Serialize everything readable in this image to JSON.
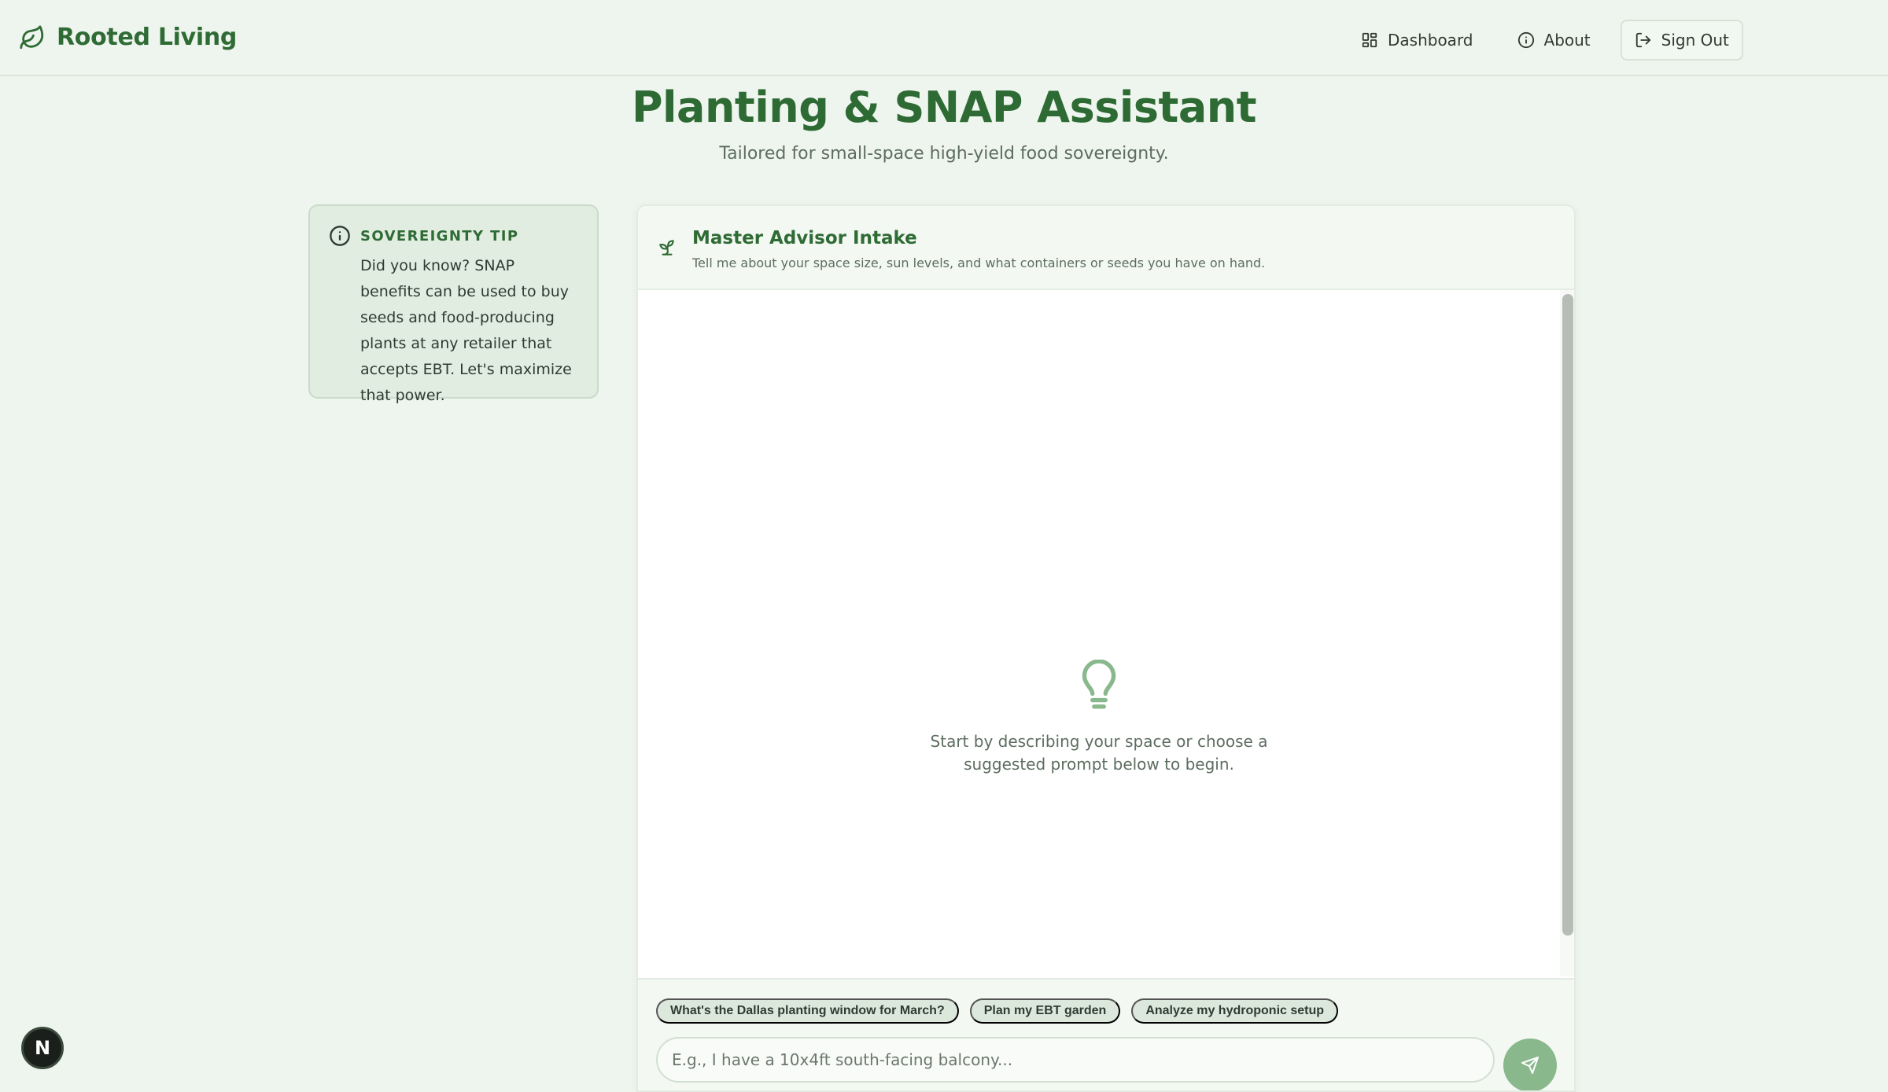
{
  "brand": {
    "name": "Rooted Living",
    "icon": "leaf-icon"
  },
  "nav": {
    "dashboard": "Dashboard",
    "about": "About",
    "sign_out": "Sign Out"
  },
  "page": {
    "title": "Planting & SNAP Assistant",
    "subtitle": "Tailored for small-space high-yield food sovereignty."
  },
  "tip": {
    "title": "SOVEREIGNTY TIP",
    "body": "Did you know? SNAP benefits can be used to buy seeds and food-producing plants at any retailer that accepts EBT. Let's maximize that power."
  },
  "chat": {
    "title": "Master Advisor Intake",
    "subtitle": "Tell me about your space size, sun levels, and what containers or seeds you have on hand.",
    "empty_text": "Start by describing your space or choose a suggested prompt below to begin.",
    "suggestions": [
      "What's the Dallas planting window for March?",
      "Plan my EBT garden",
      "Analyze my hydroponic setup"
    ],
    "input_placeholder": "E.g., I have a 10x4ft south-facing balcony..."
  },
  "badge": {
    "label": "N"
  },
  "colors": {
    "accent": "#2f6b34",
    "background": "#eef5ee",
    "send_button": "#8ab88d"
  }
}
